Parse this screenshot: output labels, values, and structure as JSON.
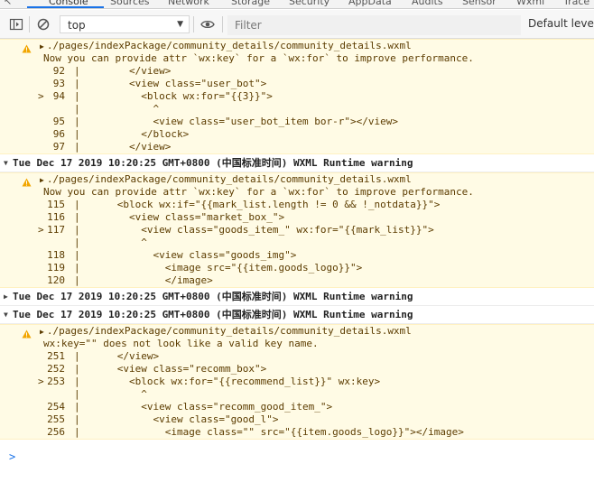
{
  "tabs": [
    "Console",
    "Sources",
    "Network",
    "Storage",
    "Security",
    "AppData",
    "Audits",
    "Sensor",
    "Wxml",
    "Trace"
  ],
  "toolbar": {
    "context": "top",
    "filter_placeholder": "Filter",
    "levels": "Default levels"
  },
  "blocks": [
    {
      "path": "./pages/indexPackage/community_details/community_details.wxml",
      "message": "Now you can provide attr `wx:key` for a `wx:for` to improve performance.",
      "lines": [
        {
          "mark": "",
          "num": "92",
          "text": "        </view>"
        },
        {
          "mark": "",
          "num": "93",
          "text": "        <view class=\"user_bot\">"
        },
        {
          "mark": ">",
          "num": "94",
          "text": "          <block wx:for=\"{{3}}\">"
        },
        {
          "mark": "",
          "num": "",
          "text": "            ^"
        },
        {
          "mark": "",
          "num": "95",
          "text": "            <view class=\"user_bot_item bor-r\"></view>"
        },
        {
          "mark": "",
          "num": "96",
          "text": "          </block>"
        },
        {
          "mark": "",
          "num": "97",
          "text": "        </view>"
        }
      ]
    },
    {
      "header": "Tue Dec 17 2019 10:20:25 GMT+0800 (",
      "header_cn": "中国标准时间",
      "header_tail": ") WXML Runtime warning",
      "path": "./pages/indexPackage/community_details/community_details.wxml",
      "message": "Now you can provide attr `wx:key` for a `wx:for` to improve performance.",
      "lines": [
        {
          "mark": "",
          "num": "115",
          "text": "      <block wx:if=\"{{mark_list.length != 0 && !_notdata}}\">"
        },
        {
          "mark": "",
          "num": "116",
          "text": "        <view class=\"market_box_\">"
        },
        {
          "mark": ">",
          "num": "117",
          "text": "          <view class=\"goods_item_\" wx:for=\"{{mark_list}}\">"
        },
        {
          "mark": "",
          "num": "",
          "text": "          ^"
        },
        {
          "mark": "",
          "num": "118",
          "text": "            <view class=\"goods_img\">"
        },
        {
          "mark": "",
          "num": "119",
          "text": "              <image src=\"{{item.goods_logo}}\">"
        },
        {
          "mark": "",
          "num": "120",
          "text": "              </image>"
        }
      ]
    },
    {
      "collapsed": true,
      "header": "Tue Dec 17 2019 10:20:25 GMT+0800 (",
      "header_cn": "中国标准时间",
      "header_tail": ") WXML Runtime warning"
    },
    {
      "header": "Tue Dec 17 2019 10:20:25 GMT+0800 (",
      "header_cn": "中国标准时间",
      "header_tail": ") WXML Runtime warning",
      "path": "./pages/indexPackage/community_details/community_details.wxml",
      "message": "wx:key=\"\" does not look like a valid key name.",
      "lines": [
        {
          "mark": "",
          "num": "251",
          "text": "      </view>"
        },
        {
          "mark": "",
          "num": "252",
          "text": "      <view class=\"recomm_box\">"
        },
        {
          "mark": ">",
          "num": "253",
          "text": "        <block wx:for=\"{{recommend_list}}\" wx:key>"
        },
        {
          "mark": "",
          "num": "",
          "text": "          ^"
        },
        {
          "mark": "",
          "num": "254",
          "text": "          <view class=\"recomm_good_item_\">"
        },
        {
          "mark": "",
          "num": "255",
          "text": "            <view class=\"good_l\">"
        },
        {
          "mark": "",
          "num": "256",
          "text": "              <image class=\"\" src=\"{{item.goods_logo}}\"></image>"
        }
      ]
    }
  ],
  "prompt": ">"
}
